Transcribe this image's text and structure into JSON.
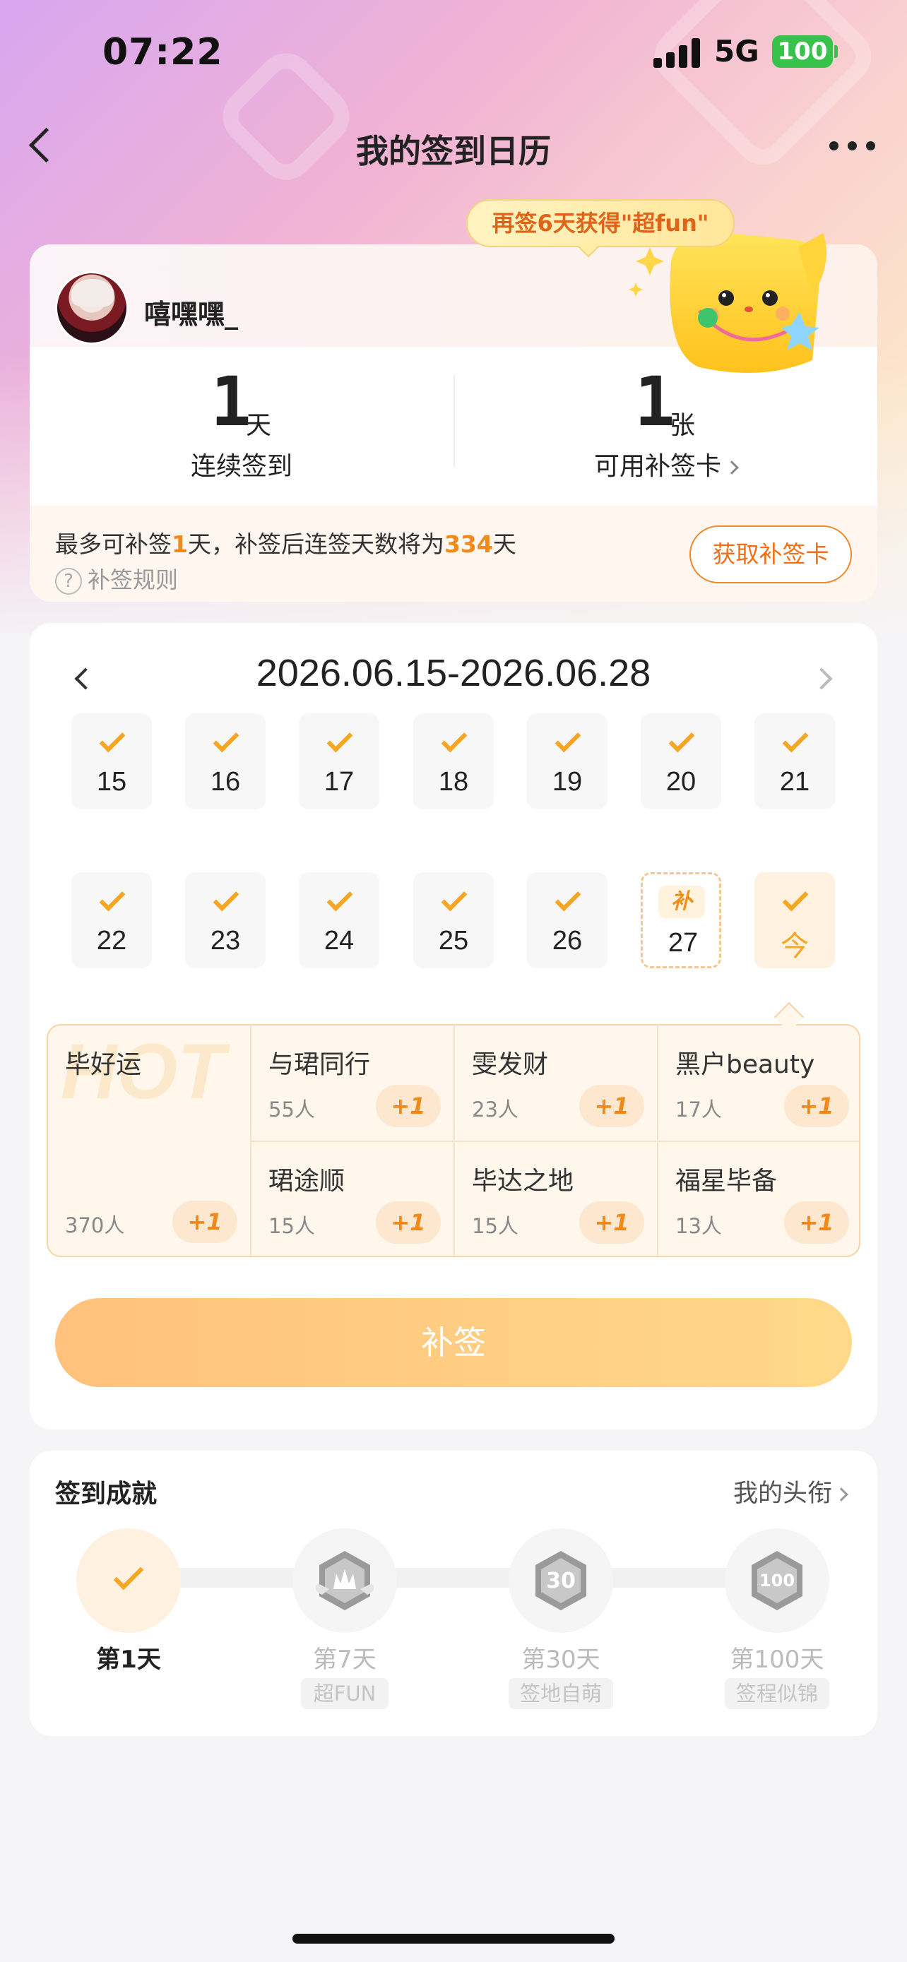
{
  "status_bar": {
    "time": "07:22",
    "network": "5G",
    "battery": "100"
  },
  "nav": {
    "title": "我的签到日历"
  },
  "promo": {
    "text": "再签6天获得\"超fun\""
  },
  "profile": {
    "username": "嘻嘿嘿_"
  },
  "stats": {
    "streak": {
      "value": "1",
      "unit": "天",
      "label": "连续签到"
    },
    "cards": {
      "value": "1",
      "unit": "张",
      "label": "可用补签卡"
    }
  },
  "makeup_info": {
    "text_part1": "最多可补签",
    "days": "1",
    "text_part2": "天，补签后连签天数将为",
    "total": "334",
    "text_part3": "天",
    "rules": "补签规则",
    "get_card": "获取补签卡"
  },
  "calendar": {
    "range": "2026.06.15-2026.06.28",
    "row1": [
      "15",
      "16",
      "17",
      "18",
      "19",
      "20",
      "21"
    ],
    "row2": [
      "22",
      "23",
      "24",
      "25",
      "26"
    ],
    "makeup_day": {
      "badge": "补",
      "num": "27"
    },
    "today": "今"
  },
  "boost": {
    "hot": {
      "bg": "HOT",
      "name": "毕好运",
      "count": "370人",
      "plus": "+1"
    },
    "cells": [
      {
        "name": "与珺同行",
        "count": "55人",
        "plus": "+1"
      },
      {
        "name": "雯发财",
        "count": "23人",
        "plus": "+1"
      },
      {
        "name": "黑户beauty",
        "count": "17人",
        "plus": "+1"
      },
      {
        "name": "珺途顺",
        "count": "15人",
        "plus": "+1"
      },
      {
        "name": "毕达之地",
        "count": "15人",
        "plus": "+1"
      },
      {
        "name": "福星毕备",
        "count": "13人",
        "plus": "+1"
      }
    ]
  },
  "makeup_button": "补签",
  "achievements": {
    "title": "签到成就",
    "link": "我的头衔",
    "milestones": [
      {
        "label": "第1天",
        "tag": ""
      },
      {
        "label": "第7天",
        "tag": "超FUN"
      },
      {
        "label": "第30天",
        "tag": "签地自萌"
      },
      {
        "label": "第100天",
        "tag": "签程似锦"
      }
    ]
  },
  "colors": {
    "accent": "#f5a623",
    "accent_text": "#f08a1a",
    "button": "#ffc17c"
  }
}
